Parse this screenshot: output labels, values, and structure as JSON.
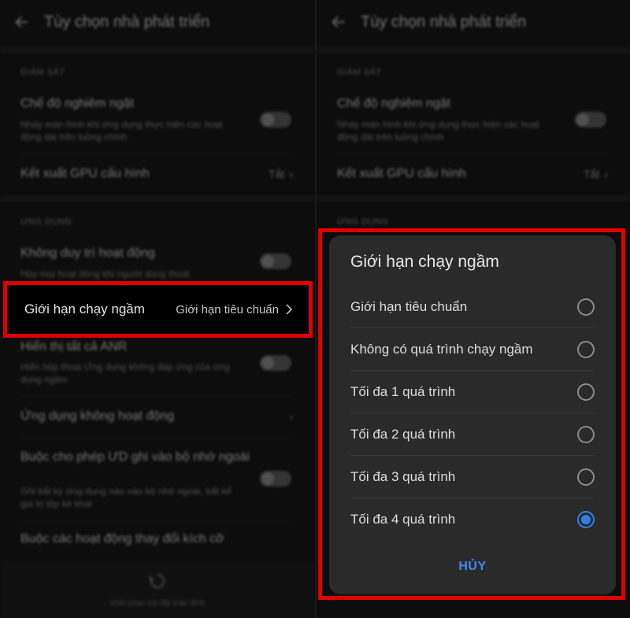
{
  "header": {
    "title": "Tùy chọn nhà phát triển"
  },
  "left": {
    "section_monitor": "GIÁM SÁT",
    "strict_mode": {
      "title": "Chế độ nghiêm ngặt",
      "subtitle": "Nháy màn hình khi ứng dụng thực hiện các hoạt động dài trên luồng chính"
    },
    "gpu_render": {
      "title": "Kết xuất GPU cấu hình",
      "value": "Tắt"
    },
    "section_apps": "ỨNG DỤNG",
    "dont_keep": {
      "title": "Không duy trì hoạt động",
      "subtitle": "Hủy mọi hoạt động khi người dùng thoát"
    },
    "bg_limit": {
      "title": "Giới hạn chạy ngầm",
      "value": "Giới hạn tiêu chuẩn"
    },
    "show_anr": {
      "title": "Hiển thị tất cả ANR",
      "subtitle": "Hiển hộp thoại Ứng dụng không đáp ứng của ứng dụng ngầm"
    },
    "inactive_apps": {
      "title": "Ứng dụng không hoạt động"
    },
    "force_external": {
      "title": "Buộc cho phép ƯD ghi vào bộ nhớ ngoài",
      "subtitle": "Ghi bất kỳ ứng dụng nào vào bộ nhớ ngoài, bất kể giá trị tệp kê khai"
    },
    "force_resizable": {
      "title": "Buộc các hoạt động thay đổi kích cỡ"
    },
    "bottom_label": "Khôi phục cài đặt mặc định"
  },
  "dialog": {
    "title": "Giới hạn chạy ngầm",
    "options": [
      {
        "label": "Giới hạn tiêu chuẩn",
        "selected": false
      },
      {
        "label": "Không có quá trình chạy ngầm",
        "selected": false
      },
      {
        "label": "Tối đa 1 quá trình",
        "selected": false
      },
      {
        "label": "Tối đa 2 quá trình",
        "selected": false
      },
      {
        "label": "Tối đa 3 quá trình",
        "selected": false
      },
      {
        "label": "Tối đa 4 quá trình",
        "selected": true
      }
    ],
    "cancel_label": "HỦY"
  },
  "colors": {
    "highlight": "#e00000",
    "accent": "#2f7fe8",
    "dialog_bg": "#2a2a2b"
  }
}
